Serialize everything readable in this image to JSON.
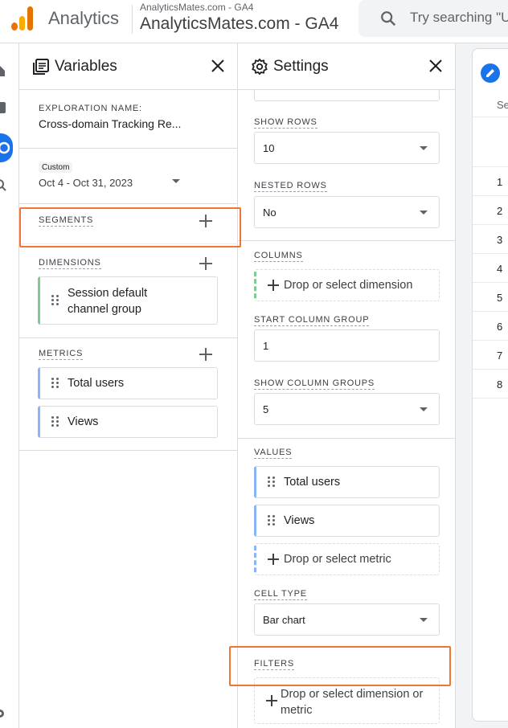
{
  "header": {
    "app_name": "Analytics",
    "account_small": "AnalyticsMates.com - GA4",
    "account_large": "AnalyticsMates.com - GA4",
    "search_placeholder": "Try searching \"U"
  },
  "variables": {
    "title": "Variables",
    "exploration_label": "EXPLORATION NAME:",
    "exploration_name": "Cross-domain Tracking Re...",
    "date_badge": "Custom",
    "date_range": "Oct 4 - Oct 31, 2023",
    "segments_label": "SEGMENTS",
    "dimensions_label": "DIMENSIONS",
    "dimension_items": [
      "Session default channel group"
    ],
    "metrics_label": "METRICS",
    "metric_items": [
      "Total users",
      "Views"
    ]
  },
  "settings": {
    "title": "Settings",
    "show_rows_label": "SHOW ROWS",
    "show_rows_value": "10",
    "nested_rows_label": "NESTED ROWS",
    "nested_rows_value": "No",
    "columns_label": "COLUMNS",
    "columns_drop": "Drop or select dimension",
    "start_column_group_label": "START COLUMN GROUP",
    "start_column_group_value": "1",
    "show_column_groups_label": "SHOW COLUMN GROUPS",
    "show_column_groups_value": "5",
    "values_label": "VALUES",
    "value_items": [
      "Total users",
      "Views"
    ],
    "values_drop": "Drop or select metric",
    "cell_type_label": "CELL TYPE",
    "cell_type_value": "Bar chart",
    "filters_label": "FILTERS",
    "filters_drop": "Drop or select dimension or metric"
  },
  "canvas": {
    "column_header": "Se",
    "row_numbers": [
      "1",
      "2",
      "3",
      "4",
      "5",
      "6",
      "7",
      "8"
    ]
  },
  "colors": {
    "highlight": "#f07634",
    "accent": "#1a73e8",
    "dimension_accent": "#81c995",
    "metric_accent": "#8ab4f8"
  },
  "icons": [
    "analytics-logo-icon",
    "search-icon",
    "variables-icon",
    "settings-gear-icon",
    "close-icon",
    "add-icon",
    "drag-handle-icon",
    "dropdown-caret-icon",
    "edit-pencil-icon"
  ]
}
